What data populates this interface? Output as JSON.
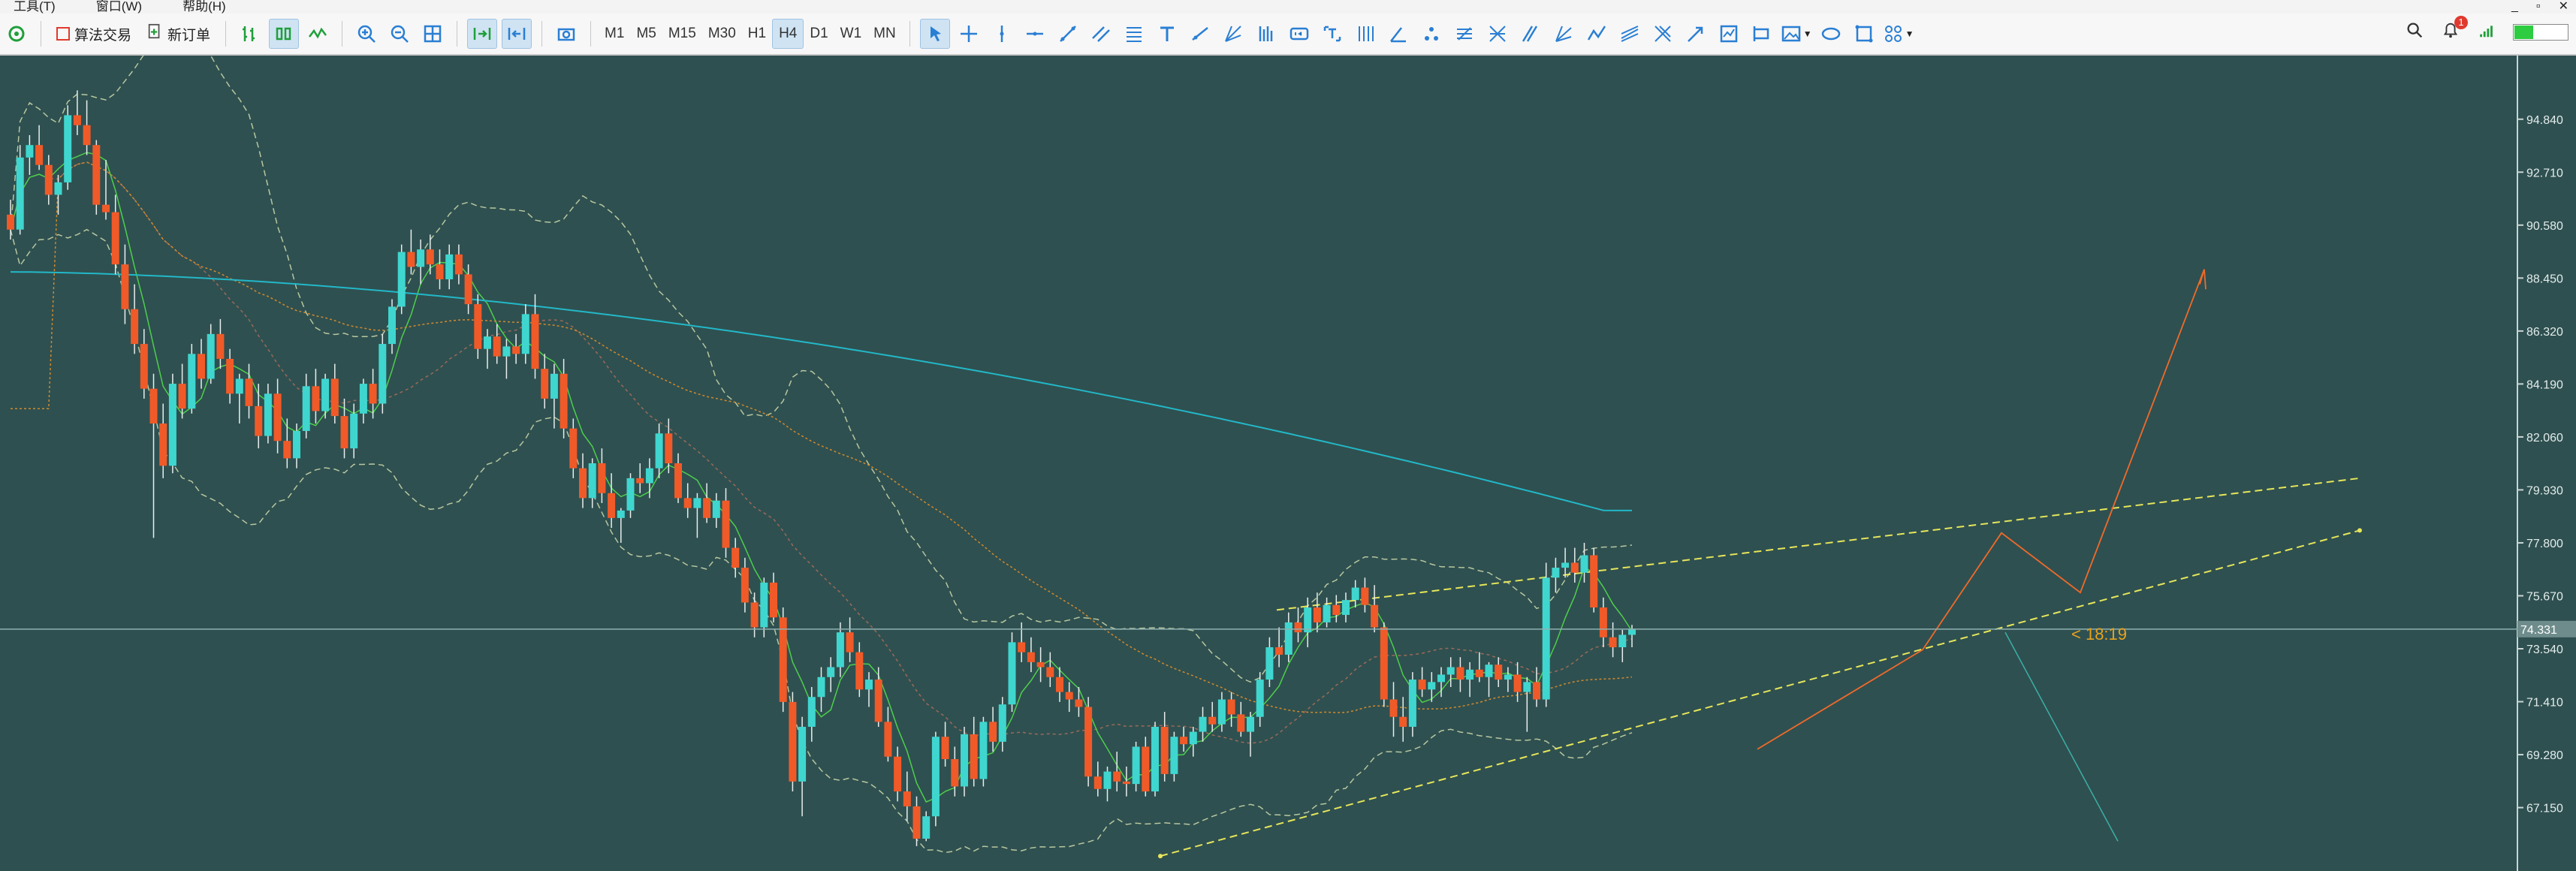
{
  "menubar": {
    "items": [
      "工具(T)",
      "窗口(W)",
      "帮助(H)"
    ],
    "window_buttons": [
      "_",
      "▫",
      "✕"
    ]
  },
  "toolbar": {
    "algo_trading_label": "算法交易",
    "new_order_label": "新订单",
    "timeframes": [
      "M1",
      "M5",
      "M15",
      "M30",
      "H1",
      "H4",
      "D1",
      "W1",
      "MN"
    ],
    "active_timeframe": "H4",
    "notification_count": "1",
    "battery_level": 0.35,
    "accent_color": "#2a7fd4"
  },
  "chart_data": {
    "type": "candlestick",
    "background": "#2f5050",
    "y_ticks": [
      "94.840",
      "92.710",
      "90.580",
      "88.450",
      "86.320",
      "84.190",
      "82.060",
      "79.930",
      "77.800",
      "75.670",
      "73.540",
      "71.410",
      "69.280",
      "67.150"
    ],
    "y_range": [
      64.6,
      97.4
    ],
    "current_price": "74.331",
    "current_price_value": 74.33,
    "countdown": "< 18:19",
    "up_color": "#3fd6cf",
    "down_color": "#f05a28",
    "candles": [
      [
        91.0,
        91.6,
        90.0,
        90.4
      ],
      [
        90.4,
        93.8,
        90.2,
        93.3
      ],
      [
        93.3,
        94.2,
        92.6,
        93.8
      ],
      [
        93.8,
        94.6,
        92.8,
        93.0
      ],
      [
        93.0,
        93.4,
        91.4,
        91.8
      ],
      [
        91.8,
        92.6,
        91.0,
        92.3
      ],
      [
        92.3,
        95.4,
        92.0,
        95.0
      ],
      [
        95.0,
        96.0,
        94.2,
        94.6
      ],
      [
        94.6,
        95.6,
        93.4,
        93.8
      ],
      [
        93.8,
        94.0,
        91.0,
        91.4
      ],
      [
        91.4,
        93.2,
        90.8,
        91.1
      ],
      [
        91.1,
        91.8,
        88.6,
        89.0
      ],
      [
        89.0,
        89.8,
        86.6,
        87.2
      ],
      [
        87.2,
        88.2,
        85.4,
        85.8
      ],
      [
        85.8,
        86.4,
        83.6,
        84.0
      ],
      [
        84.0,
        84.6,
        78.0,
        82.6
      ],
      [
        82.6,
        83.4,
        80.4,
        80.9
      ],
      [
        80.9,
        84.6,
        80.6,
        84.2
      ],
      [
        84.2,
        85.0,
        82.8,
        83.2
      ],
      [
        83.2,
        85.8,
        83.0,
        85.4
      ],
      [
        85.4,
        86.0,
        84.0,
        84.4
      ],
      [
        84.4,
        86.6,
        84.2,
        86.2
      ],
      [
        86.2,
        86.8,
        84.8,
        85.2
      ],
      [
        85.2,
        85.6,
        83.4,
        83.8
      ],
      [
        83.8,
        84.6,
        82.6,
        84.4
      ],
      [
        84.4,
        85.0,
        82.8,
        83.3
      ],
      [
        83.3,
        84.2,
        81.6,
        82.1
      ],
      [
        82.1,
        84.2,
        81.8,
        83.8
      ],
      [
        83.8,
        84.4,
        81.4,
        81.9
      ],
      [
        81.9,
        82.8,
        80.8,
        81.2
      ],
      [
        81.2,
        82.6,
        80.8,
        82.3
      ],
      [
        82.3,
        84.6,
        82.0,
        84.1
      ],
      [
        84.1,
        84.8,
        82.6,
        83.1
      ],
      [
        83.1,
        84.6,
        82.8,
        84.4
      ],
      [
        84.4,
        85.0,
        82.6,
        82.9
      ],
      [
        82.9,
        83.6,
        81.2,
        81.6
      ],
      [
        81.6,
        83.4,
        81.2,
        83.0
      ],
      [
        83.0,
        84.4,
        82.6,
        84.2
      ],
      [
        84.2,
        84.8,
        82.8,
        83.4
      ],
      [
        83.4,
        86.2,
        83.0,
        85.8
      ],
      [
        85.8,
        87.6,
        85.4,
        87.3
      ],
      [
        87.3,
        89.8,
        87.0,
        89.5
      ],
      [
        89.5,
        90.4,
        88.6,
        88.9
      ],
      [
        88.9,
        90.0,
        88.2,
        89.6
      ],
      [
        89.6,
        90.2,
        88.6,
        89.0
      ],
      [
        89.0,
        89.6,
        88.0,
        88.4
      ],
      [
        88.4,
        89.8,
        88.0,
        89.4
      ],
      [
        89.4,
        89.8,
        88.2,
        88.6
      ],
      [
        88.6,
        89.0,
        87.0,
        87.4
      ],
      [
        87.4,
        87.8,
        85.2,
        85.6
      ],
      [
        85.6,
        86.4,
        84.8,
        86.1
      ],
      [
        86.1,
        86.6,
        85.0,
        85.3
      ],
      [
        85.3,
        86.0,
        84.4,
        85.7
      ],
      [
        85.7,
        86.2,
        85.0,
        85.4
      ],
      [
        85.4,
        87.4,
        85.0,
        87.0
      ],
      [
        87.0,
        87.8,
        84.4,
        84.8
      ],
      [
        84.8,
        85.4,
        83.2,
        83.6
      ],
      [
        83.6,
        85.0,
        82.4,
        84.6
      ],
      [
        84.6,
        85.2,
        82.0,
        82.4
      ],
      [
        82.4,
        82.8,
        80.4,
        80.8
      ],
      [
        80.8,
        81.4,
        79.2,
        79.6
      ],
      [
        79.6,
        81.2,
        79.2,
        81.0
      ],
      [
        81.0,
        81.6,
        79.4,
        79.8
      ],
      [
        79.8,
        80.6,
        78.4,
        78.8
      ],
      [
        78.8,
        79.2,
        77.8,
        79.1
      ],
      [
        79.1,
        80.6,
        78.8,
        80.4
      ],
      [
        80.4,
        81.0,
        79.8,
        80.2
      ],
      [
        80.2,
        81.2,
        79.6,
        80.8
      ],
      [
        80.8,
        82.6,
        80.4,
        82.2
      ],
      [
        82.2,
        82.8,
        80.6,
        81.0
      ],
      [
        81.0,
        81.4,
        79.4,
        79.6
      ],
      [
        79.6,
        80.2,
        78.8,
        79.2
      ],
      [
        79.2,
        79.8,
        78.0,
        79.6
      ],
      [
        79.6,
        80.2,
        78.6,
        78.8
      ],
      [
        78.8,
        79.8,
        78.4,
        79.5
      ],
      [
        79.5,
        80.0,
        77.2,
        77.6
      ],
      [
        77.6,
        78.0,
        76.4,
        76.8
      ],
      [
        76.8,
        77.2,
        75.0,
        75.4
      ],
      [
        75.4,
        75.8,
        74.0,
        74.4
      ],
      [
        74.4,
        76.4,
        74.0,
        76.2
      ],
      [
        76.2,
        76.6,
        74.6,
        74.8
      ],
      [
        74.8,
        75.2,
        71.0,
        71.4
      ],
      [
        71.4,
        71.8,
        67.8,
        68.2
      ],
      [
        68.2,
        70.8,
        66.8,
        70.4
      ],
      [
        70.4,
        72.0,
        69.8,
        71.6
      ],
      [
        71.6,
        72.8,
        71.0,
        72.4
      ],
      [
        72.4,
        73.2,
        71.8,
        72.8
      ],
      [
        72.8,
        74.6,
        72.4,
        74.2
      ],
      [
        74.2,
        74.8,
        73.0,
        73.4
      ],
      [
        73.4,
        73.8,
        71.6,
        71.9
      ],
      [
        71.9,
        72.6,
        71.2,
        72.3
      ],
      [
        72.3,
        72.8,
        70.4,
        70.6
      ],
      [
        70.6,
        71.2,
        69.0,
        69.2
      ],
      [
        69.2,
        69.6,
        67.4,
        67.8
      ],
      [
        67.8,
        68.6,
        66.6,
        67.2
      ],
      [
        67.2,
        67.6,
        65.6,
        65.9
      ],
      [
        65.9,
        67.0,
        65.8,
        66.8
      ],
      [
        66.8,
        70.2,
        66.4,
        70.0
      ],
      [
        70.0,
        70.6,
        68.8,
        69.1
      ],
      [
        69.1,
        69.6,
        67.6,
        68.0
      ],
      [
        68.0,
        70.4,
        67.6,
        70.1
      ],
      [
        70.1,
        70.8,
        68.0,
        68.3
      ],
      [
        68.3,
        70.8,
        68.0,
        70.6
      ],
      [
        70.6,
        71.2,
        69.4,
        69.8
      ],
      [
        69.8,
        71.6,
        69.4,
        71.3
      ],
      [
        71.3,
        74.2,
        71.0,
        73.8
      ],
      [
        73.8,
        74.6,
        73.0,
        73.4
      ],
      [
        73.4,
        74.0,
        72.6,
        73.0
      ],
      [
        73.0,
        73.6,
        72.2,
        72.8
      ],
      [
        72.8,
        73.4,
        72.0,
        72.4
      ],
      [
        72.4,
        72.8,
        71.4,
        71.8
      ],
      [
        71.8,
        72.2,
        71.0,
        71.5
      ],
      [
        71.5,
        72.0,
        70.8,
        71.2
      ],
      [
        71.2,
        71.6,
        68.0,
        68.4
      ],
      [
        68.4,
        69.0,
        67.6,
        67.9
      ],
      [
        67.9,
        68.8,
        67.4,
        68.6
      ],
      [
        68.6,
        69.4,
        67.8,
        68.2
      ],
      [
        68.2,
        68.8,
        67.6,
        68.1
      ],
      [
        68.1,
        69.8,
        67.8,
        69.6
      ],
      [
        69.6,
        70.0,
        67.6,
        67.8
      ],
      [
        67.8,
        70.6,
        67.6,
        70.4
      ],
      [
        70.4,
        71.0,
        68.2,
        68.5
      ],
      [
        68.5,
        70.2,
        68.2,
        70.0
      ],
      [
        70.0,
        70.4,
        69.4,
        69.7
      ],
      [
        69.7,
        70.4,
        69.2,
        70.2
      ],
      [
        70.2,
        71.2,
        69.8,
        70.8
      ],
      [
        70.8,
        71.4,
        70.2,
        70.5
      ],
      [
        70.5,
        71.8,
        70.2,
        71.5
      ],
      [
        71.5,
        71.8,
        70.4,
        70.9
      ],
      [
        70.9,
        71.4,
        70.0,
        70.2
      ],
      [
        70.2,
        71.0,
        69.2,
        70.8
      ],
      [
        70.8,
        72.6,
        70.4,
        72.3
      ],
      [
        72.3,
        74.0,
        72.0,
        73.6
      ],
      [
        73.6,
        74.4,
        72.8,
        73.3
      ],
      [
        73.3,
        75.0,
        73.0,
        74.6
      ],
      [
        74.6,
        75.2,
        73.8,
        74.2
      ],
      [
        74.2,
        75.6,
        73.6,
        75.2
      ],
      [
        75.2,
        75.8,
        74.2,
        74.6
      ],
      [
        74.6,
        75.6,
        74.4,
        75.3
      ],
      [
        75.3,
        75.7,
        74.6,
        74.9
      ],
      [
        74.9,
        75.8,
        74.6,
        75.5
      ],
      [
        75.5,
        76.3,
        75.2,
        76.0
      ],
      [
        76.0,
        76.4,
        75.0,
        75.3
      ],
      [
        75.3,
        76.1,
        74.2,
        74.4
      ],
      [
        74.4,
        74.6,
        71.2,
        71.5
      ],
      [
        71.5,
        72.2,
        70.0,
        70.8
      ],
      [
        70.8,
        71.6,
        69.8,
        70.4
      ],
      [
        70.4,
        72.6,
        70.0,
        72.3
      ],
      [
        72.3,
        72.8,
        71.6,
        71.9
      ],
      [
        71.9,
        72.6,
        71.4,
        72.2
      ],
      [
        72.2,
        72.8,
        71.6,
        72.5
      ],
      [
        72.5,
        73.2,
        72.0,
        72.8
      ],
      [
        72.8,
        73.2,
        71.8,
        72.3
      ],
      [
        72.3,
        73.0,
        71.6,
        72.7
      ],
      [
        72.7,
        73.4,
        72.2,
        72.4
      ],
      [
        72.4,
        73.0,
        71.6,
        72.9
      ],
      [
        72.9,
        73.2,
        72.0,
        72.3
      ],
      [
        72.3,
        72.8,
        71.8,
        72.5
      ],
      [
        72.5,
        73.0,
        71.4,
        71.8
      ],
      [
        71.8,
        72.4,
        70.2,
        72.2
      ],
      [
        72.2,
        72.8,
        71.2,
        71.5
      ],
      [
        71.5,
        77.0,
        71.2,
        76.4
      ],
      [
        76.4,
        77.2,
        75.8,
        76.8
      ],
      [
        76.8,
        77.6,
        76.4,
        77.0
      ],
      [
        77.0,
        77.6,
        76.2,
        76.6
      ],
      [
        76.6,
        77.8,
        76.2,
        77.3
      ],
      [
        77.3,
        77.6,
        75.0,
        75.2
      ],
      [
        75.2,
        75.6,
        73.6,
        74.0
      ],
      [
        74.0,
        74.6,
        73.2,
        73.6
      ],
      [
        73.6,
        74.3,
        73.0,
        74.1
      ],
      [
        74.1,
        74.5,
        73.6,
        74.33
      ]
    ]
  }
}
